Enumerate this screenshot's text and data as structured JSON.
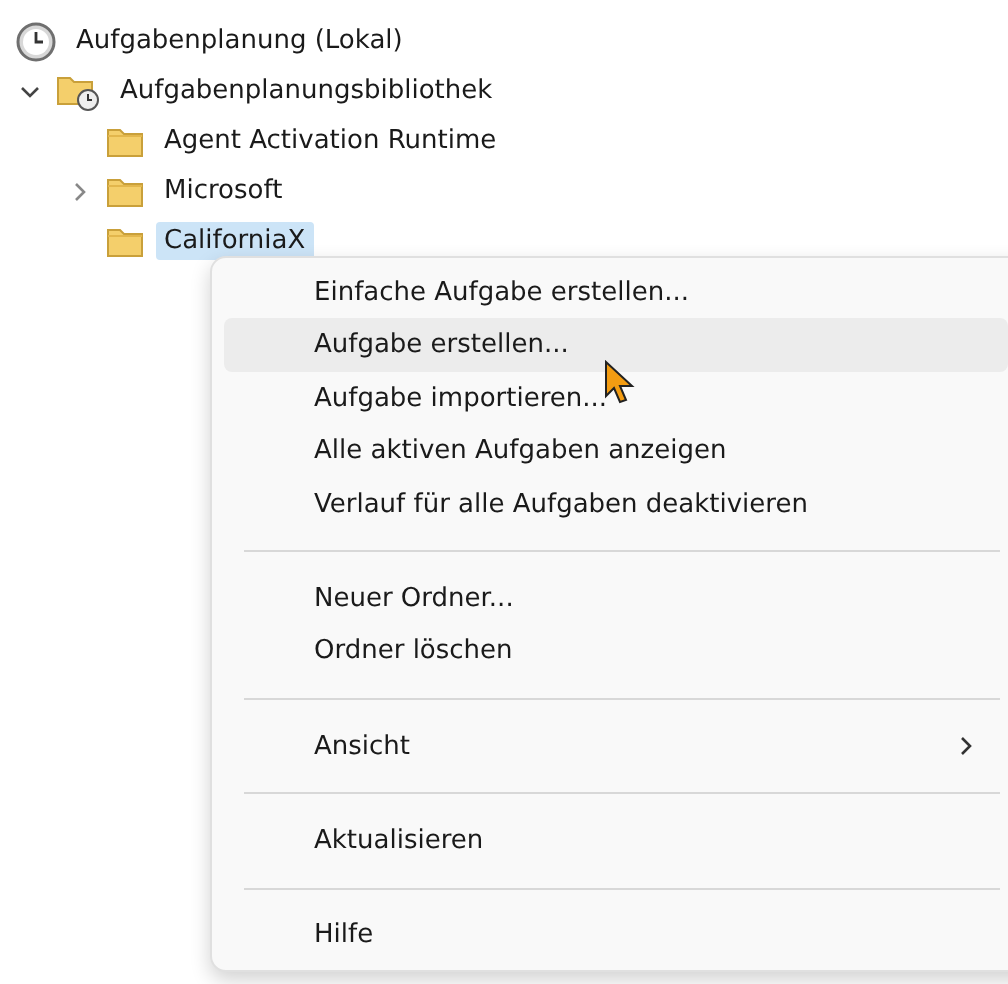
{
  "tree": [
    {
      "label": "Aufgabenplanung (Lokal)",
      "kind": "clock",
      "selected": false,
      "children": [
        {
          "label": "Aufgabenplanungsbibliothek",
          "kind": "library",
          "expanded": true,
          "selected": false,
          "children": [
            {
              "label": "Agent Activation Runtime",
              "kind": "folder",
              "selected": false
            },
            {
              "label": "Microsoft",
              "kind": "folder",
              "expanded": false,
              "selected": false
            },
            {
              "label": "CaliforniaX",
              "kind": "folder",
              "selected": true
            }
          ]
        }
      ]
    }
  ],
  "context_menu": {
    "items": [
      {
        "kind": "item",
        "label": "Einfache Aufgabe erstellen...",
        "hovered": false,
        "submenu": false
      },
      {
        "kind": "item",
        "label": "Aufgabe erstellen...",
        "hovered": true,
        "submenu": false
      },
      {
        "kind": "item",
        "label": "Aufgabe importieren...",
        "hovered": false,
        "submenu": false
      },
      {
        "kind": "item",
        "label": "Alle aktiven Aufgaben anzeigen",
        "hovered": false,
        "submenu": false
      },
      {
        "kind": "item",
        "label": "Verlauf für alle Aufgaben deaktivieren",
        "hovered": false,
        "submenu": false
      },
      {
        "kind": "separator"
      },
      {
        "kind": "item",
        "label": "Neuer Ordner...",
        "hovered": false,
        "submenu": false
      },
      {
        "kind": "item",
        "label": "Ordner löschen",
        "hovered": false,
        "submenu": false
      },
      {
        "kind": "separator"
      },
      {
        "kind": "item",
        "label": "Ansicht",
        "hovered": false,
        "submenu": true
      },
      {
        "kind": "separator"
      },
      {
        "kind": "item",
        "label": "Aktualisieren",
        "hovered": false,
        "submenu": false
      },
      {
        "kind": "separator"
      },
      {
        "kind": "item",
        "label": "Hilfe",
        "hovered": false,
        "submenu": false
      }
    ]
  }
}
